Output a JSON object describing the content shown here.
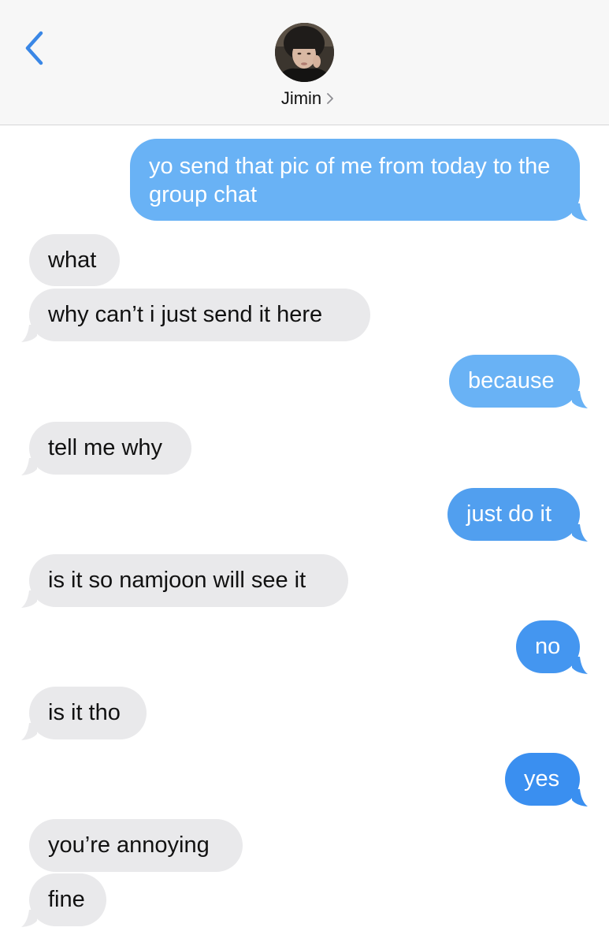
{
  "header": {
    "back_icon": "chevron-left-icon",
    "contact_name": "Jimin",
    "contact_chevron": "chevron-right-icon",
    "accent_color": "#3a87e6"
  },
  "colors": {
    "sent_bubble": "#3a93f3",
    "sent_bubble_light": "#69b2f5",
    "received_bubble": "#e9e9eb"
  },
  "messages": [
    {
      "from": "me",
      "text": "yo send that pic of me from today to the group chat"
    },
    {
      "from": "them",
      "text": "what"
    },
    {
      "from": "them",
      "text": "why can’t i just send it here"
    },
    {
      "from": "me",
      "text": "because"
    },
    {
      "from": "them",
      "text": "tell me why"
    },
    {
      "from": "me",
      "text": "just do it"
    },
    {
      "from": "them",
      "text": "is it so namjoon will see it"
    },
    {
      "from": "me",
      "text": "no"
    },
    {
      "from": "them",
      "text": "is it tho"
    },
    {
      "from": "me",
      "text": "yes"
    },
    {
      "from": "them",
      "text": "you’re annoying"
    },
    {
      "from": "them",
      "text": "fine"
    }
  ]
}
